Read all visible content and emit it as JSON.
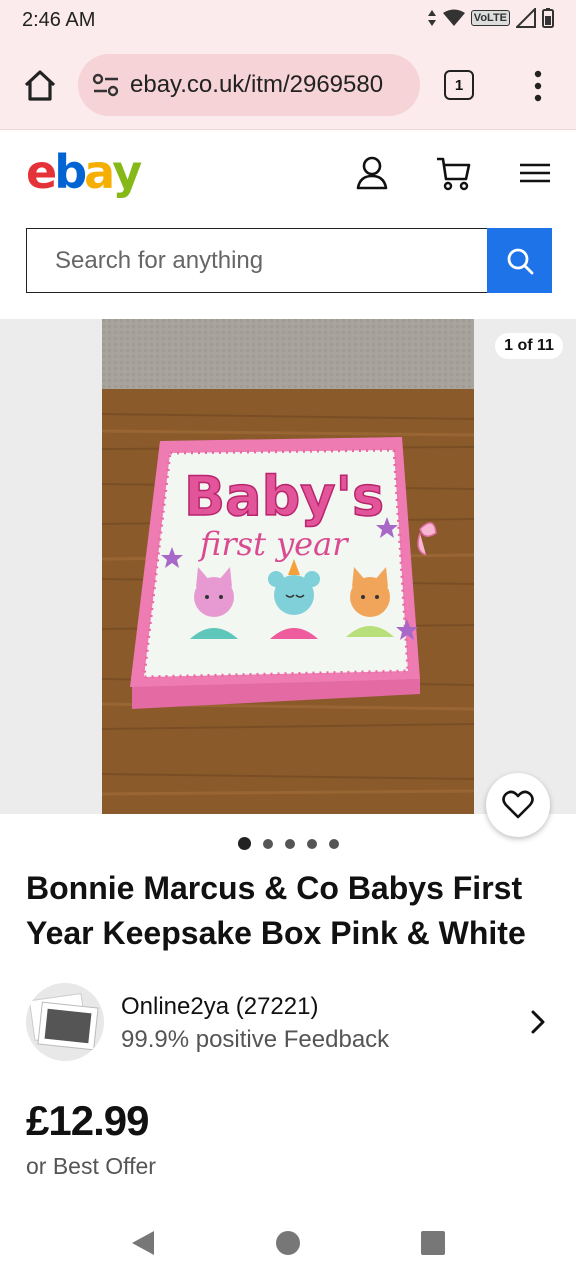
{
  "status_bar": {
    "time": "2:46 AM",
    "network_badge": "VoLTE",
    "icons": [
      "data-arrows-icon",
      "wifi-icon",
      "signal-icon",
      "battery-icon"
    ]
  },
  "browser": {
    "url": "ebay.co.uk/itm/2969580",
    "tab_count": "1",
    "icons": [
      "home-icon",
      "site-settings-icon",
      "more-vert-icon"
    ]
  },
  "header": {
    "logo_letters": [
      "e",
      "b",
      "a",
      "y"
    ],
    "logo_colors": [
      "#e53238",
      "#0064d2",
      "#f5af02",
      "#86b817"
    ],
    "icons": [
      "account-icon",
      "cart-icon",
      "menu-icon"
    ]
  },
  "search": {
    "placeholder": "Search for anything",
    "button_color": "#1f73e8"
  },
  "gallery": {
    "counter": "1 of 11",
    "dots_total": 5,
    "dots_active": 1
  },
  "listing": {
    "title": "Bonnie Marcus & Co Babys First Year Keepsake Box Pink & White",
    "seller_name": "Online2ya (27221)",
    "seller_feedback": "99.9% positive Feedback",
    "price": "£12.99",
    "offer_text": "or Best Offer"
  },
  "product_image": {
    "box_title": "Baby's",
    "box_subtitle": "first year"
  },
  "nav_bar": {
    "icons": [
      "back-icon",
      "home-circle-icon",
      "recents-icon"
    ]
  }
}
